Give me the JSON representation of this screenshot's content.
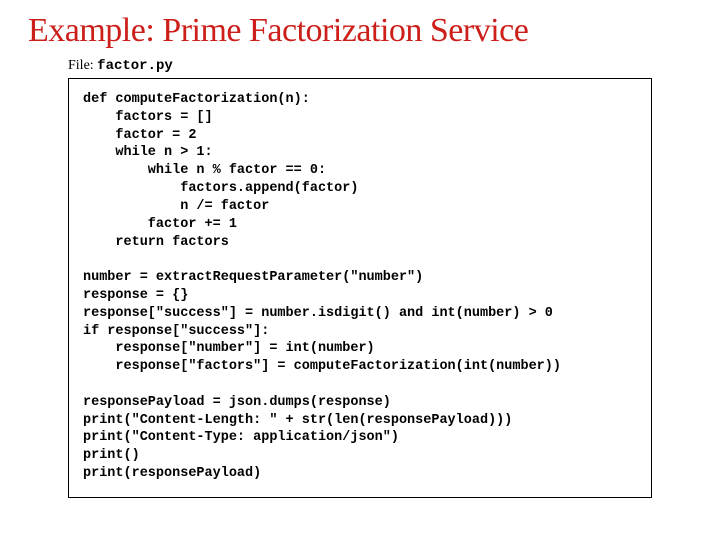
{
  "title": "Example: Prime Factorization Service",
  "file": {
    "label": "File: ",
    "name": "factor.py"
  },
  "code": "def computeFactorization(n):\n    factors = []\n    factor = 2\n    while n > 1:\n        while n % factor == 0:\n            factors.append(factor)\n            n /= factor\n        factor += 1\n    return factors\n\nnumber = extractRequestParameter(\"number\")\nresponse = {}\nresponse[\"success\"] = number.isdigit() and int(number) > 0\nif response[\"success\"]:\n    response[\"number\"] = int(number)\n    response[\"factors\"] = computeFactorization(int(number))\n\nresponsePayload = json.dumps(response)\nprint(\"Content-Length: \" + str(len(responsePayload)))\nprint(\"Content-Type: application/json\")\nprint()\nprint(responsePayload)"
}
